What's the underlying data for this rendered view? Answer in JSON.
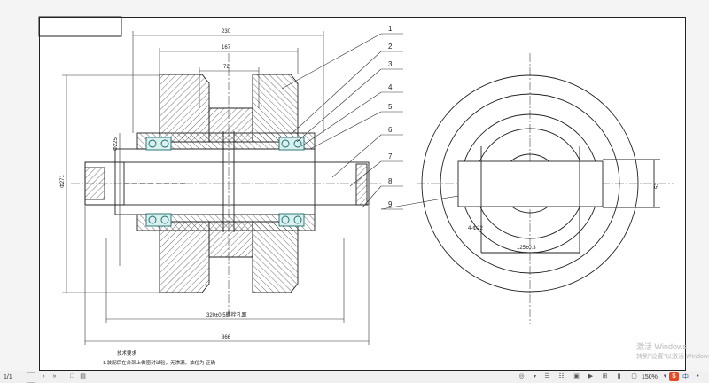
{
  "drawing": {
    "balloons": [
      "1",
      "2",
      "3",
      "4",
      "5",
      "6",
      "7",
      "8",
      "9"
    ],
    "dimensions": {
      "d230": "230",
      "d167": "167",
      "d72": "72",
      "d225": "Φ225",
      "d271": "Φ271",
      "bolt_spacing": "320±0.5螺栓孔距",
      "d366": "366",
      "holes": "4-Φ22",
      "d125": "125±0.3",
      "d52": "52"
    },
    "tech_title": "技术要求",
    "tech_note": "1.装配后在台架上做密封试验，无渗漏。油位为  正确"
  },
  "statusbar": {
    "page": "1/1",
    "zoom": "150%",
    "ime": "中"
  },
  "watermark": {
    "line1": "激活 Windows",
    "line2": "转到\"设置\"以激活 Windows。"
  }
}
